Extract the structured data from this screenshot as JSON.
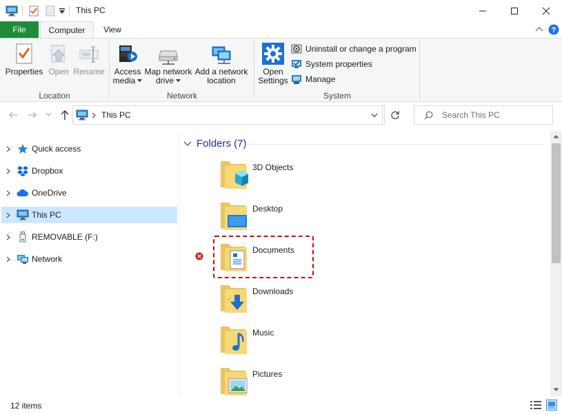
{
  "window": {
    "title": "This PC"
  },
  "ribbon_tabs": {
    "file": "File",
    "computer": "Computer",
    "view": "View"
  },
  "ribbon": {
    "location": {
      "label": "Location",
      "properties": "Properties",
      "open": "Open",
      "rename": "Rename"
    },
    "network": {
      "label": "Network",
      "access_media_l1": "Access",
      "access_media_l2": "media",
      "map_drive_l1": "Map network",
      "map_drive_l2": "drive",
      "add_location_l1": "Add a network",
      "add_location_l2": "location"
    },
    "system": {
      "label": "System",
      "open_settings_l1": "Open",
      "open_settings_l2": "Settings",
      "uninstall": "Uninstall or change a program",
      "system_properties": "System properties",
      "manage": "Manage"
    }
  },
  "address": {
    "path": "This PC",
    "search_placeholder": "Search This PC"
  },
  "nav": {
    "items": [
      {
        "label": "Quick access",
        "icon": "star-icon"
      },
      {
        "label": "Dropbox",
        "icon": "dropbox-icon"
      },
      {
        "label": "OneDrive",
        "icon": "cloud-icon"
      },
      {
        "label": "This PC",
        "icon": "monitor-icon",
        "selected": true
      },
      {
        "label": "REMOVABLE (F:)",
        "icon": "usb-drive-icon"
      },
      {
        "label": "Network",
        "icon": "network-icon"
      }
    ]
  },
  "content": {
    "section_title": "Folders (7)",
    "folders": [
      {
        "name": "3D Objects",
        "icon": "3d-objects-folder-icon"
      },
      {
        "name": "Desktop",
        "icon": "desktop-folder-icon"
      },
      {
        "name": "Documents",
        "icon": "documents-folder-icon",
        "highlighted": true,
        "status": "error"
      },
      {
        "name": "Downloads",
        "icon": "downloads-folder-icon"
      },
      {
        "name": "Music",
        "icon": "music-folder-icon"
      },
      {
        "name": "Pictures",
        "icon": "pictures-folder-icon"
      }
    ]
  },
  "status": {
    "items_count": "12 items"
  },
  "colors": {
    "file_tab": "#1e8c3a",
    "selection": "#cce8ff",
    "section_title": "#1e3287",
    "highlight_border": "#d40000",
    "help": "#1a73e8"
  }
}
